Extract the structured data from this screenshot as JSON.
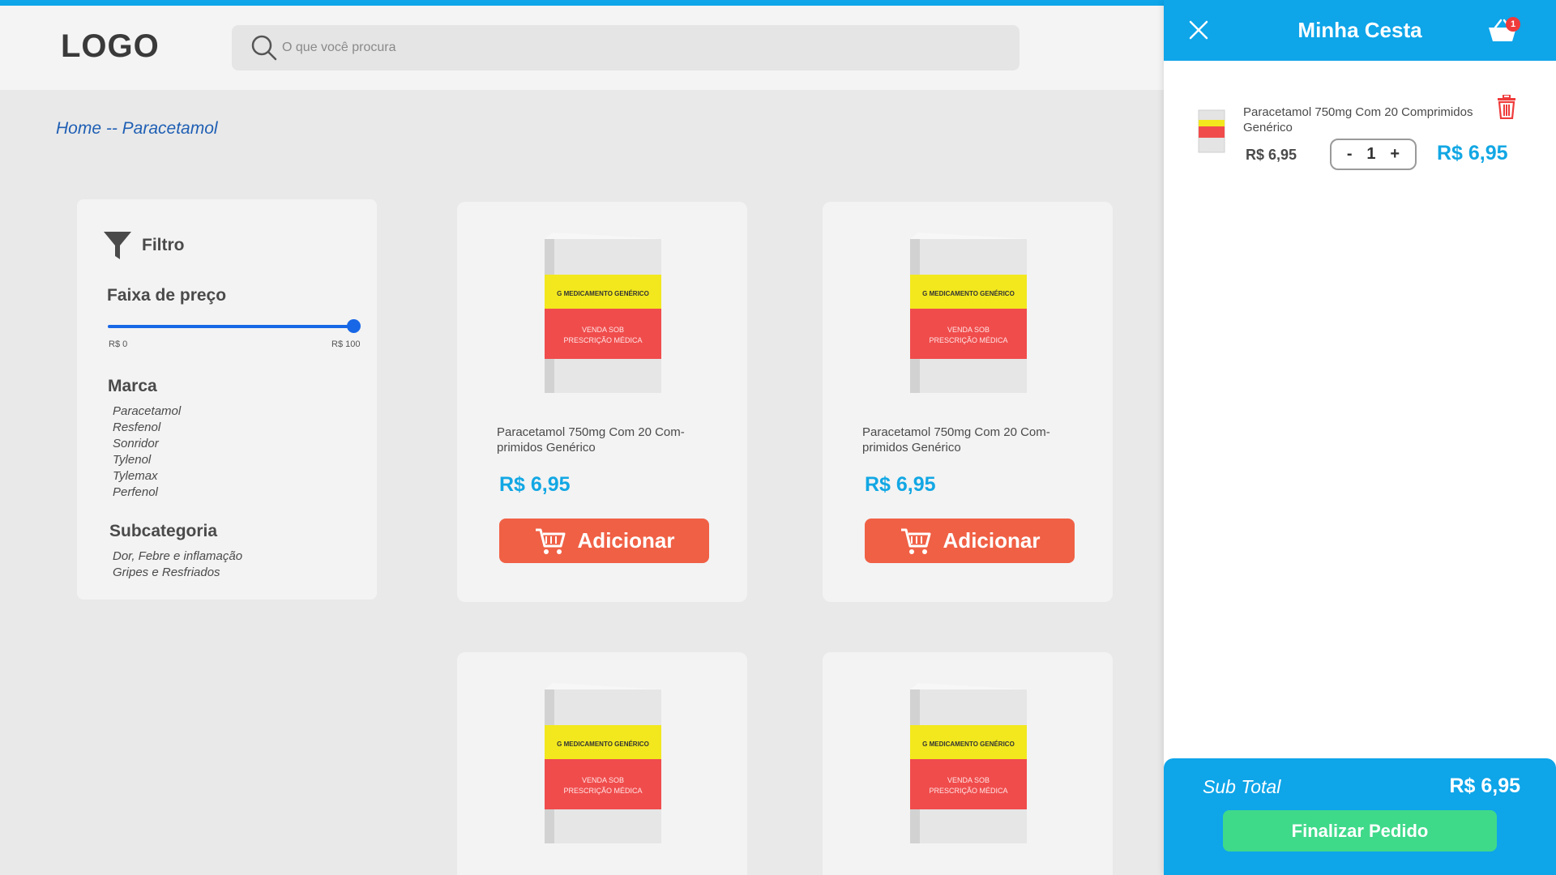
{
  "header": {
    "logo": "LOGO",
    "search_placeholder": "O que você procura"
  },
  "breadcrumb": "Home -- Paracetamol",
  "filter": {
    "title": "Filtro",
    "price_range": {
      "title": "Faixa de preço",
      "min_label": "R$ 0",
      "max_label": "R$ 100",
      "value_percent": 100
    },
    "brand": {
      "title": "Marca",
      "items": [
        "Paracetamol",
        "Resfenol",
        "Sonridor",
        "Tylenol",
        "Tylemax",
        "Perfenol"
      ]
    },
    "subcategory": {
      "title": "Subcategoria",
      "items": [
        "Dor, Febre e inflamação",
        "Gripes e Resfriados"
      ]
    }
  },
  "products": [
    {
      "name": "Paracetamol 750mg Com 20 Com-primidos Genérico",
      "price": "R$ 6,95",
      "button": "Adicionar"
    },
    {
      "name": "Paracetamol 750mg Com 20 Com-primidos Genérico",
      "price": "R$ 6,95",
      "button": "Adicionar"
    },
    {
      "name": "",
      "price": "",
      "button": ""
    },
    {
      "name": "",
      "price": "",
      "button": ""
    }
  ],
  "package_art": {
    "band_top": "G MEDICAMENTO GENÉRICO",
    "band_line1": "VENDA SOB",
    "band_line2": "PRESCRIÇÃO MÉDICA"
  },
  "cart": {
    "title": "Minha Cesta",
    "badge_count": "1",
    "item": {
      "name": "Paracetamol 750mg Com 20 Comprimidos Genérico",
      "unit_price": "R$ 6,95",
      "qty_minus": "-",
      "quantity": "1",
      "qty_plus": "+",
      "total": "R$ 6,95"
    },
    "subtotal_label": "Sub Total",
    "subtotal_value": "R$ 6,95",
    "checkout_button": "Finalizar Pedido"
  },
  "colors": {
    "accent": "#0ea5e9",
    "price": "#12a7e4",
    "add_button": "#f06045",
    "checkout_button": "#3fd98a",
    "slider": "#1867e6"
  }
}
